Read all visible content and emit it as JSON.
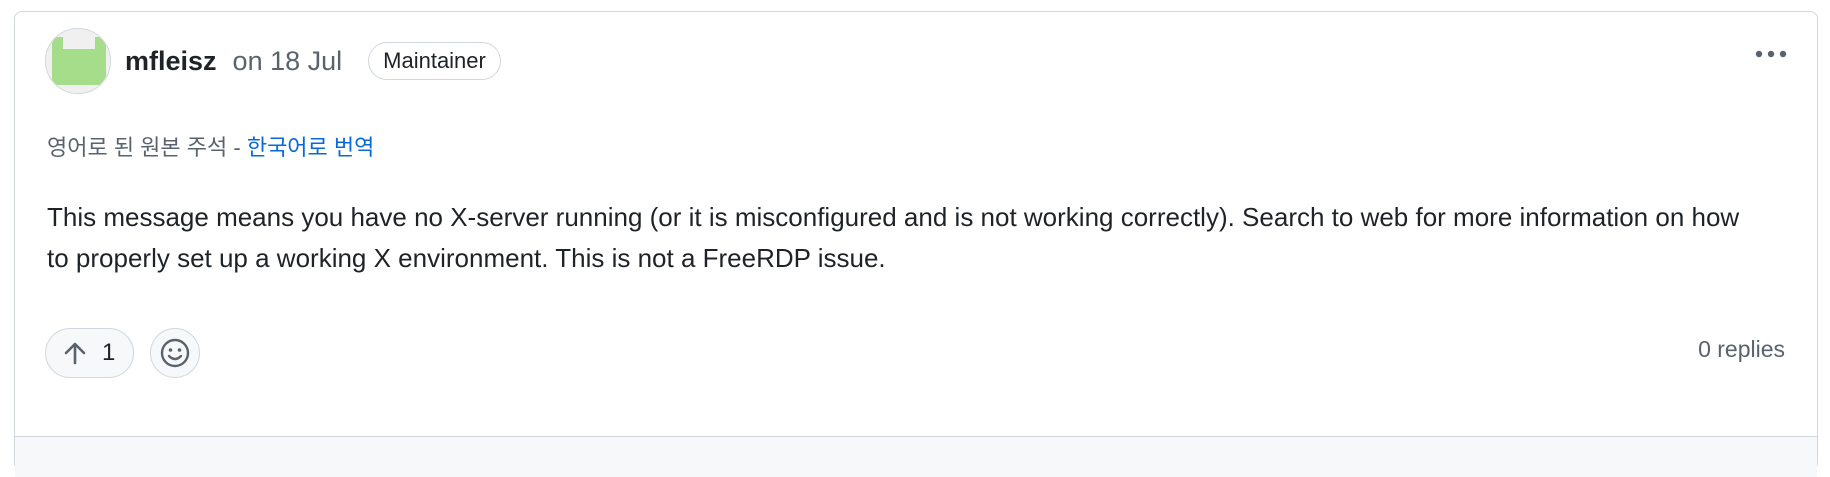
{
  "comment": {
    "author": "mfleisz",
    "date": "on 18 Jul",
    "role_badge": "Maintainer",
    "translation": {
      "original_note": "영어로 된 원본 주석 -",
      "translate_link": "한국어로 번역"
    },
    "body": "This message means you have no X-server running (or it is misconfigured and is not working correctly). Search to web for more information on how to properly set up a working X environment. This is not a FreeRDP issue.",
    "upvotes": "1",
    "replies": "0 replies"
  },
  "icons": {
    "avatar": "identicon-avatar",
    "more": "kebab-menu-icon",
    "upvote": "arrow-up-icon",
    "reaction": "smiley-icon"
  },
  "colors": {
    "link": "#0969da",
    "border": "#d0d7de",
    "muted_text": "#59636e",
    "avatar_green": "#a6dd8b"
  }
}
